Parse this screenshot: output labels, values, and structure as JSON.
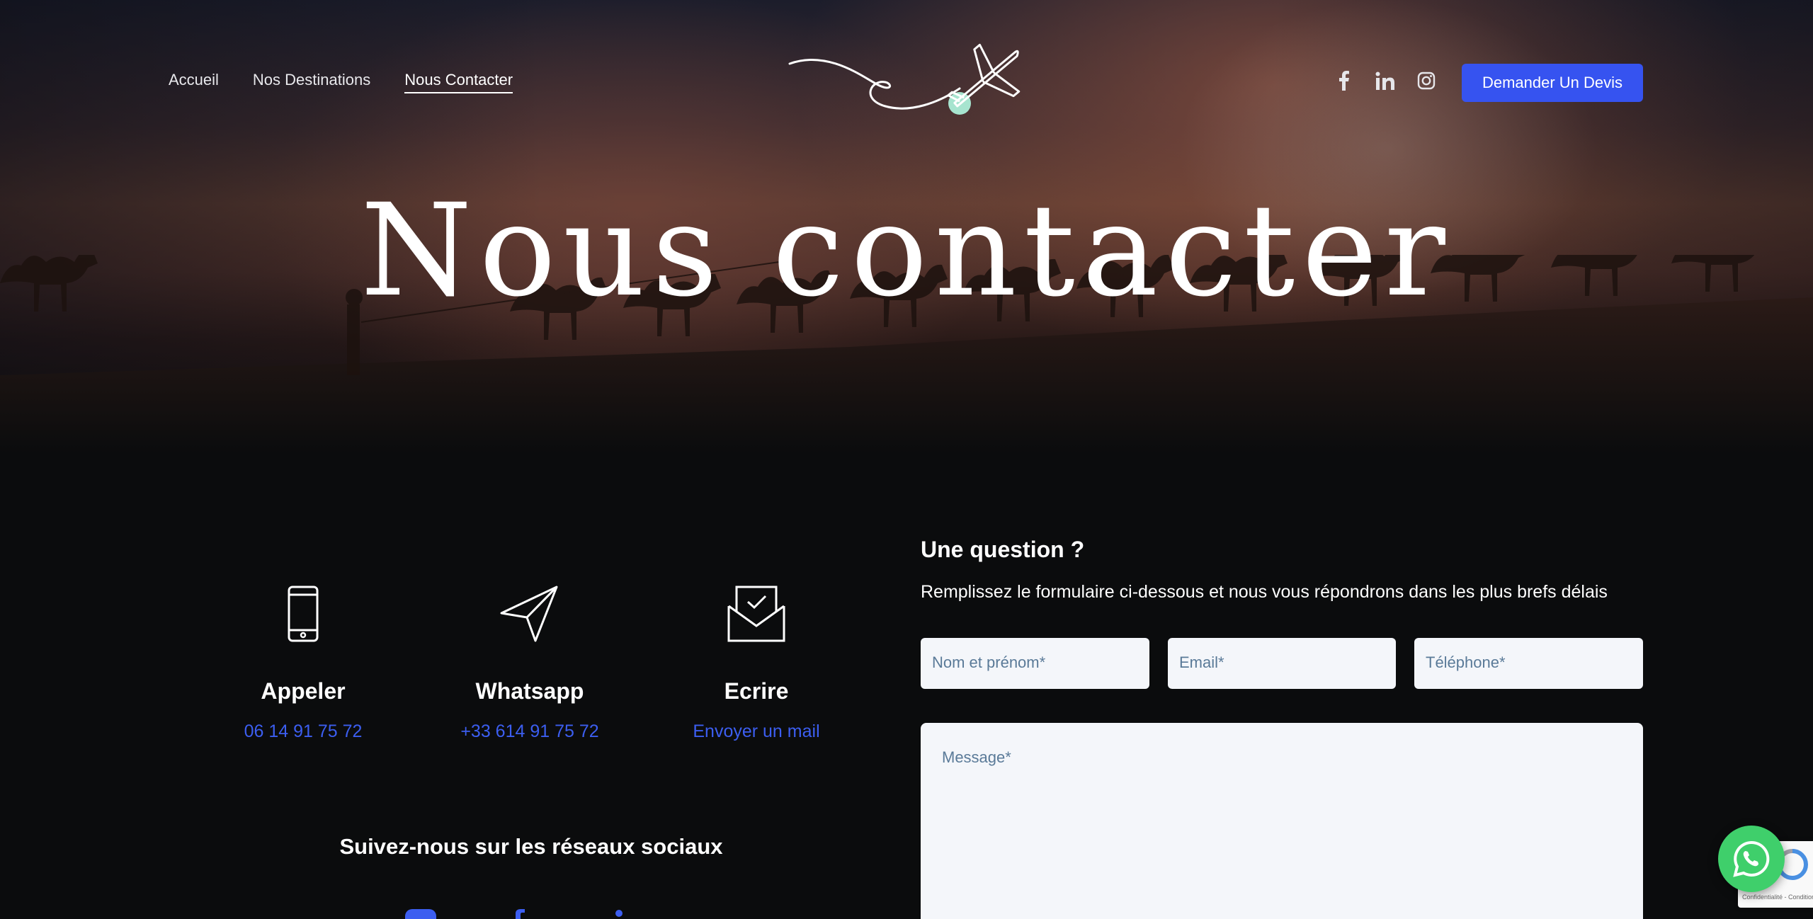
{
  "nav": {
    "items": [
      {
        "label": "Accueil"
      },
      {
        "label": "Nos Destinations"
      },
      {
        "label": "Nous Contacter"
      }
    ]
  },
  "header": {
    "socials": [
      "facebook-icon",
      "linkedin-icon",
      "instagram-icon"
    ],
    "cta_label": "Demander Un Devis"
  },
  "hero": {
    "title": "Nous contacter"
  },
  "contacts": [
    {
      "icon": "phone-icon",
      "title": "Appeler",
      "link": "06 14 91 75 72"
    },
    {
      "icon": "paper-plane-icon",
      "title": "Whatsapp",
      "link": "+33 614 91 75 72"
    },
    {
      "icon": "envelope-icon",
      "title": "Ecrire",
      "link": "Envoyer un mail"
    }
  ],
  "follow": {
    "label": "Suivez-nous sur les réseaux sociaux"
  },
  "form": {
    "title": "Une question ?",
    "subtitle": "Remplissez le formulaire ci-dessous et nous vous répondrons dans les plus brefs délais",
    "name_placeholder": "Nom et prénom*",
    "email_placeholder": "Email*",
    "phone_placeholder": "Téléphone*",
    "message_placeholder": "Message*"
  },
  "recaptcha": {
    "text": "Confidentialité - Conditions"
  },
  "colors": {
    "accent": "#3653f0",
    "link": "#3c5ef0",
    "whatsapp": "#3fcf6b"
  }
}
